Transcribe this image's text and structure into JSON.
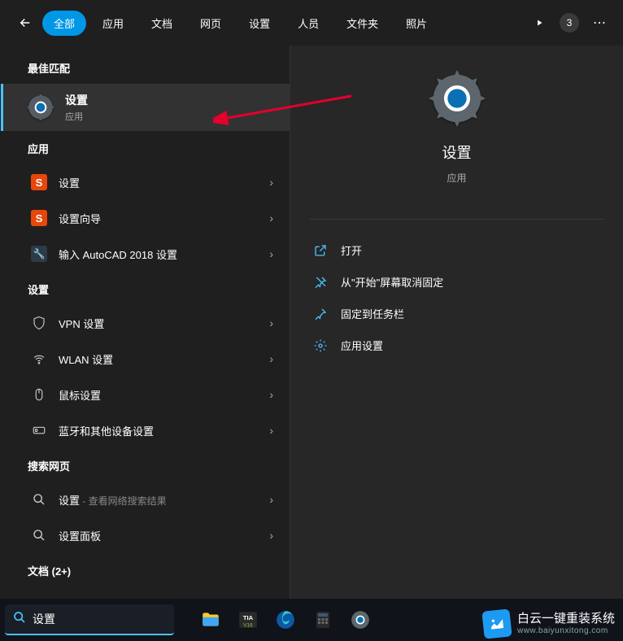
{
  "header": {
    "tabs": [
      "全部",
      "应用",
      "文档",
      "网页",
      "设置",
      "人员",
      "文件夹",
      "照片"
    ],
    "active_tab_index": 0,
    "badge_count": "3"
  },
  "sections": {
    "best_match_label": "最佳匹配",
    "apps_label": "应用",
    "settings_label": "设置",
    "web_label": "搜索网页",
    "docs_label": "文档 (2+)"
  },
  "best_match": {
    "title": "设置",
    "subtitle": "应用"
  },
  "apps": [
    {
      "icon": "sogou",
      "label": "设置"
    },
    {
      "icon": "sogou",
      "label": "设置向导"
    },
    {
      "icon": "wrench",
      "label": "输入 AutoCAD 2018 设置"
    }
  ],
  "settings": [
    {
      "icon": "shield",
      "label": "VPN 设置"
    },
    {
      "icon": "wifi",
      "label": "WLAN 设置"
    },
    {
      "icon": "mouse",
      "label": "鼠标设置"
    },
    {
      "icon": "bluetooth",
      "label": "蓝牙和其他设备设置"
    }
  ],
  "web": [
    {
      "icon": "search",
      "label": "设置",
      "suffix": " - 查看网络搜索结果"
    },
    {
      "icon": "search",
      "label": "设置面板",
      "suffix": ""
    }
  ],
  "preview": {
    "title": "设置",
    "subtitle": "应用",
    "actions": [
      {
        "icon": "open",
        "label": "打开"
      },
      {
        "icon": "unpin",
        "label": "从\"开始\"屏幕取消固定"
      },
      {
        "icon": "pin",
        "label": "固定到任务栏"
      },
      {
        "icon": "gear",
        "label": "应用设置"
      }
    ]
  },
  "search_value": "设置",
  "watermark": {
    "line1": "白云一键重装系统",
    "line2": "www.baiyunxitong.com"
  },
  "sogou_glyph": "S"
}
